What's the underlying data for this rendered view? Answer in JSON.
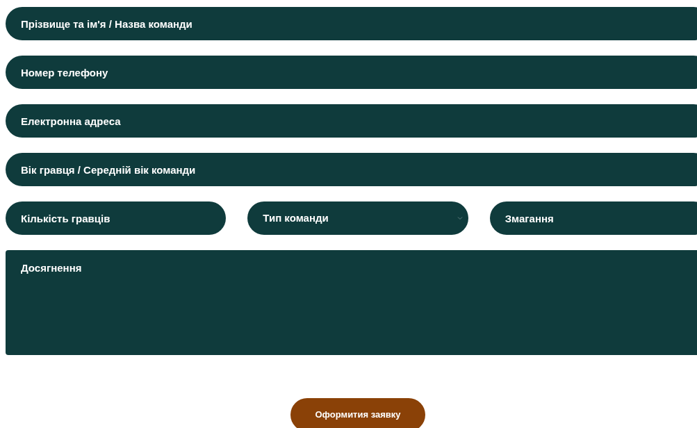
{
  "rows": [
    {
      "fields": [
        {
          "kind": "text",
          "placeholder": "Прізвище та ім'я / Назва команди"
        }
      ]
    },
    {
      "fields": [
        {
          "kind": "text",
          "placeholder": "Номер телефону"
        }
      ]
    },
    {
      "fields": [
        {
          "kind": "text",
          "placeholder": "Електронна адреса"
        }
      ]
    },
    {
      "fields": [
        {
          "kind": "text",
          "placeholder": "Вік гравця / Середній вік команди"
        }
      ]
    },
    {
      "fields": [
        {
          "kind": "text",
          "placeholder": "Кількість гравців"
        },
        {
          "kind": "select",
          "value": "Тип команди"
        },
        {
          "kind": "text",
          "placeholder": "Змагання"
        }
      ]
    },
    {
      "fields": [
        {
          "kind": "textarea",
          "placeholder": "Досягнення"
        }
      ]
    }
  ],
  "submit_button": "Оформития заявку"
}
